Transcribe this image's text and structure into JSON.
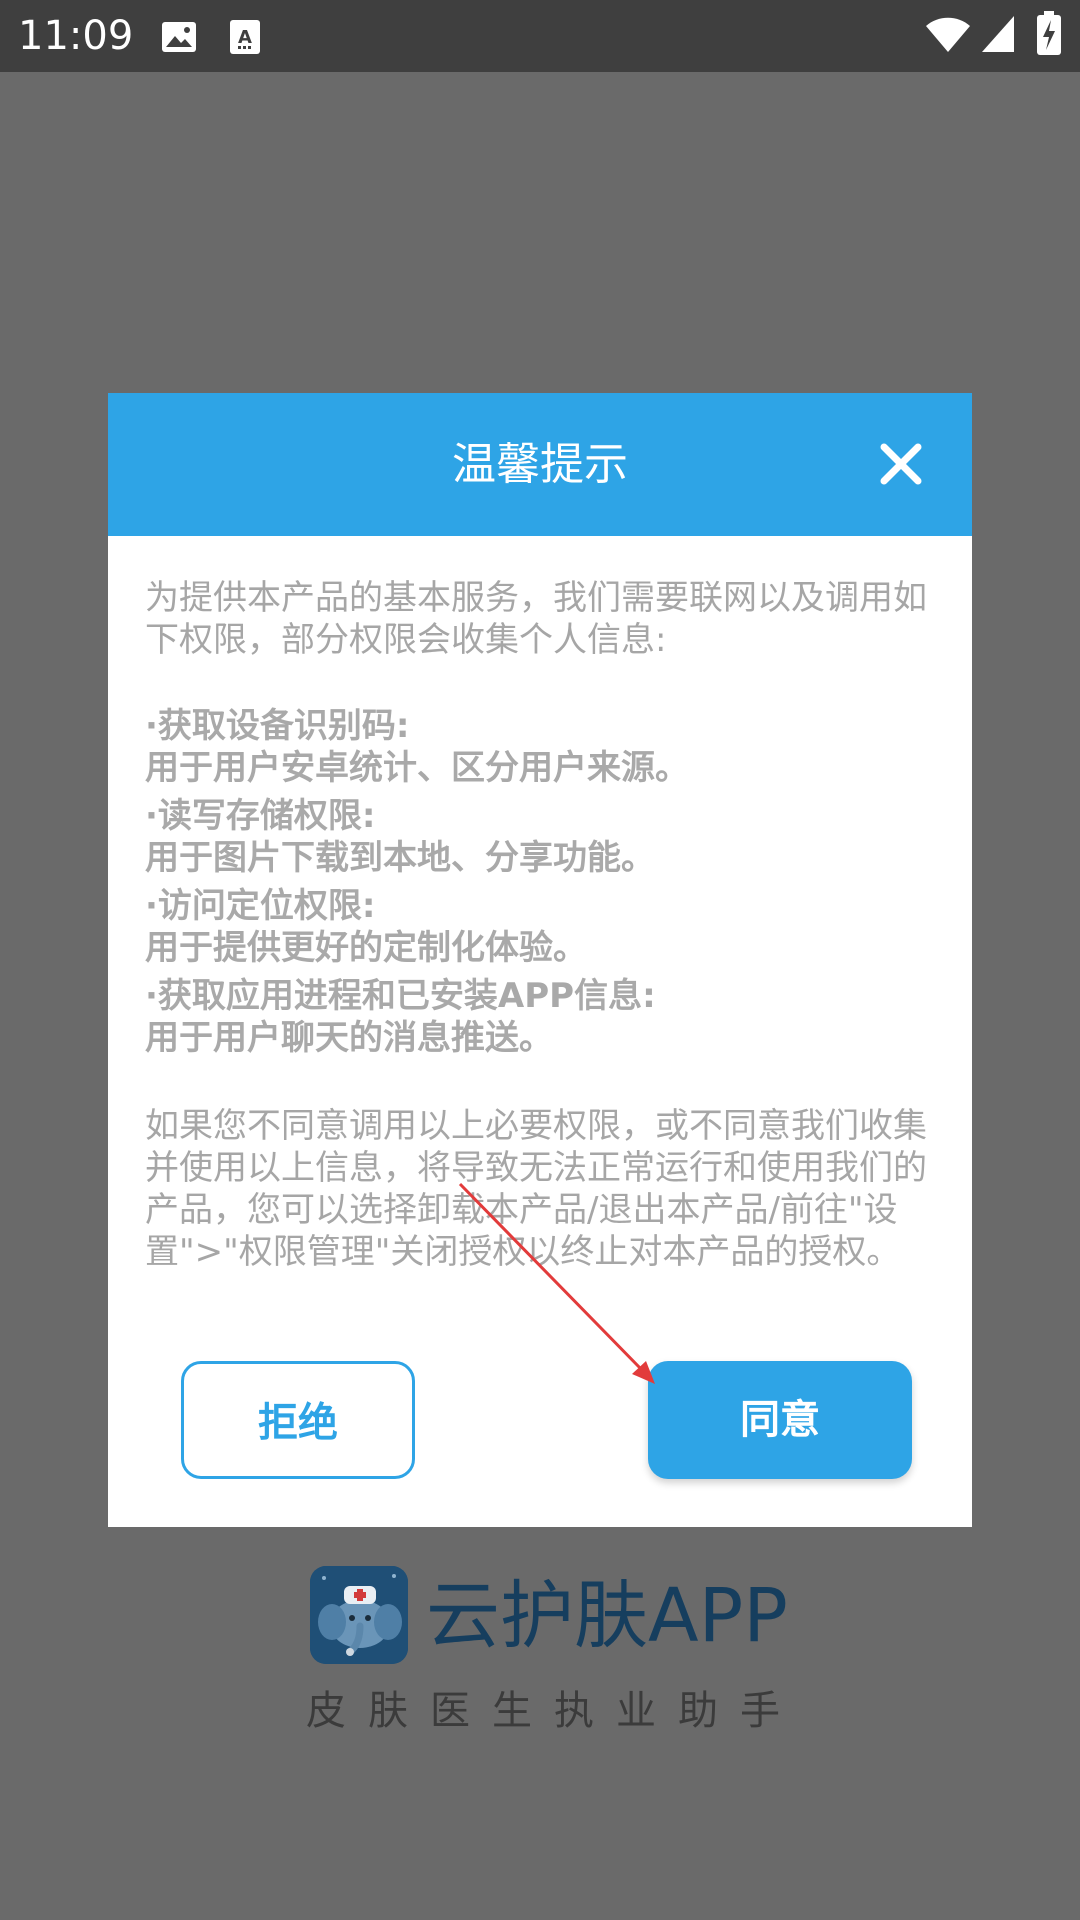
{
  "status_bar": {
    "time": "11:09",
    "icons": [
      "image-icon",
      "text-notification-icon",
      "wifi-icon",
      "signal-icon",
      "battery-charging-icon"
    ]
  },
  "dialog": {
    "title": "温馨提示",
    "intro": "为提供本产品的基本服务，我们需要联网以及调用如下权限，部分权限会收集个人信息:",
    "permissions": [
      {
        "title": "·获取设备识别码:",
        "desc": "用于用户安卓统计、区分用户来源。"
      },
      {
        "title": "·读写存储权限:",
        "desc": "用于图片下载到本地、分享功能。"
      },
      {
        "title": "·访问定位权限:",
        "desc": "用于提供更好的定制化体验。"
      },
      {
        "title": "·获取应用进程和已安装APP信息:",
        "desc": "用于用户聊天的消息推送。"
      }
    ],
    "notice": "如果您不同意调用以上必要权限，或不同意我们收集并使用以上信息，将导致无法正常运行和使用我们的产品，您可以选择卸载本产品/退出本产品/前往\"设置\">\"权限管理\"关闭授权以终止对本产品的授权。",
    "reject_label": "拒绝",
    "agree_label": "同意"
  },
  "background_app": {
    "name": "云护肤APP",
    "tagline": "皮肤医生执业助手"
  },
  "colors": {
    "accent": "#2ea4e6",
    "overlay": "#6a6a6a",
    "status_bar": "#3f3f3f",
    "annotation": "#e23b3b"
  }
}
